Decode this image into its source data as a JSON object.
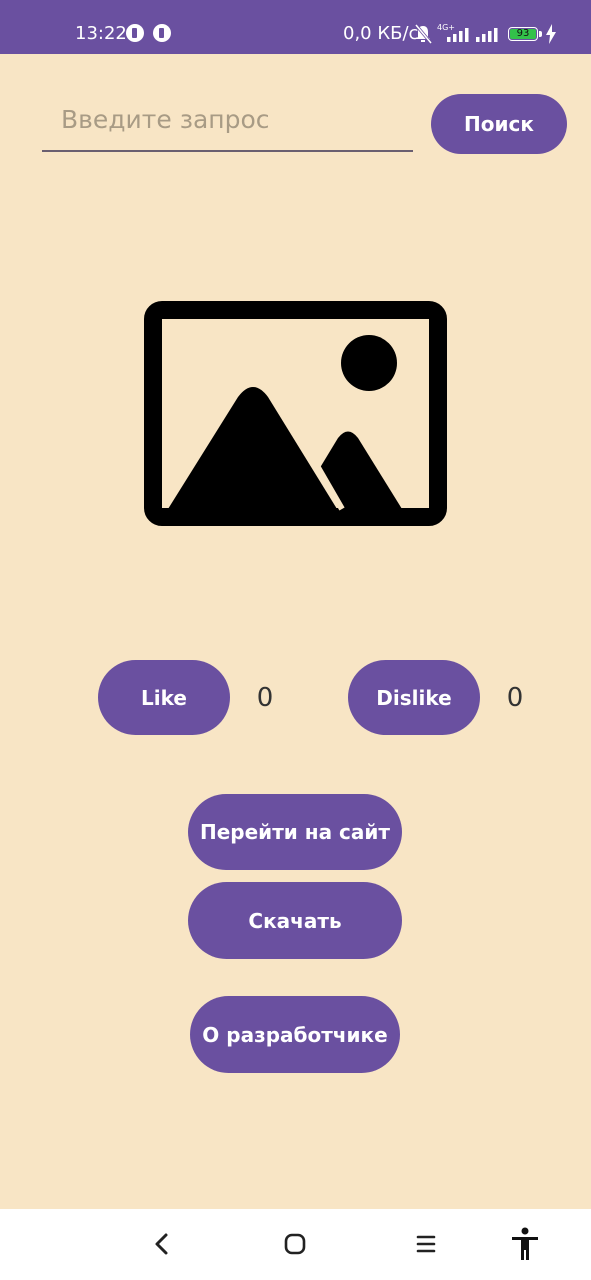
{
  "status_bar": {
    "time": "13:22",
    "net_speed": "0,0 КБ/с",
    "network_type": "4G+",
    "battery_level": "93",
    "icons": [
      "app-icon",
      "app-icon",
      "mute-icon",
      "signal-icon",
      "signal-icon",
      "battery-icon",
      "charging-icon"
    ]
  },
  "search": {
    "placeholder": "Введите запрос",
    "value": "",
    "button_label": "Поиск"
  },
  "image": {
    "icon": "image-placeholder-icon"
  },
  "reactions": {
    "like_label": "Like",
    "like_count": "0",
    "dislike_label": "Dislike",
    "dislike_count": "0"
  },
  "actions": {
    "site_label": "Перейти на сайт",
    "download_label": "Скачать",
    "about_label": "О разработчике"
  },
  "nav_bar": {
    "icons": [
      "back-icon",
      "home-icon",
      "menu-icon",
      "accessibility-icon"
    ]
  },
  "colors": {
    "primary": "#6a50a0",
    "background": "#f8e5c5",
    "text": "#333333",
    "button_text": "#ffffff"
  }
}
